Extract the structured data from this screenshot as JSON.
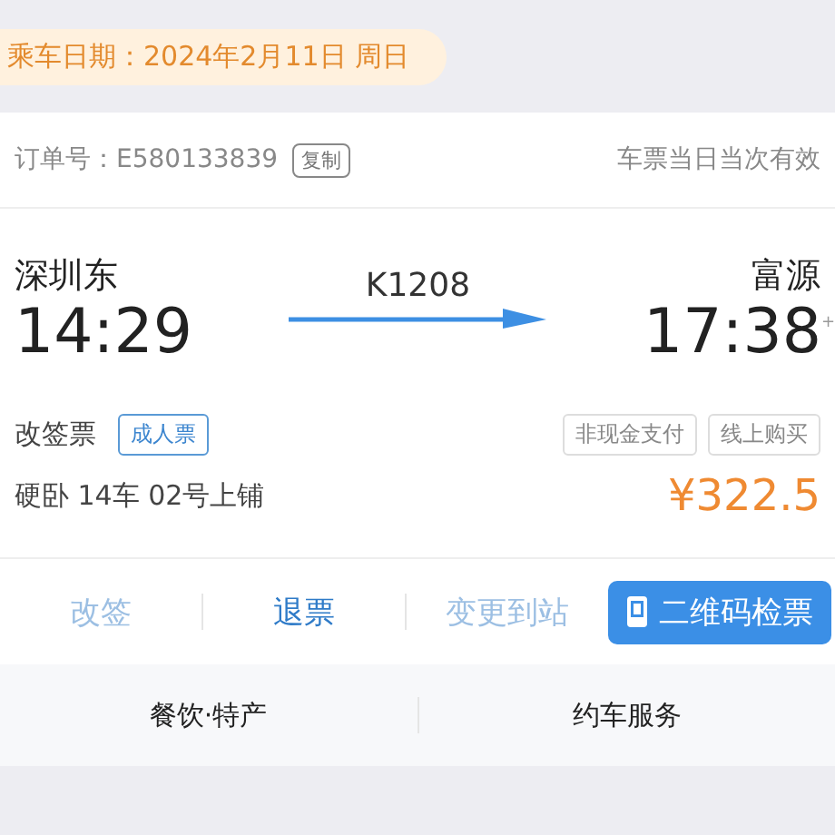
{
  "travel_date": "乘车日期：2024年2月11日 周日",
  "order": {
    "label": "订单号：E580133839",
    "copy_button": "复制",
    "validity": "车票当日当次有效"
  },
  "trip": {
    "from_station": "深圳东",
    "depart_time": "14:29",
    "train_no": "K1208",
    "to_station": "富源",
    "arrive_time": "17:38",
    "arrive_mark": "+"
  },
  "ticket": {
    "type": "改签票",
    "passenger_tag": "成人票",
    "payment_tags": [
      "非现金支付",
      "线上购买"
    ],
    "seat": "硬卧 14车 02号上铺",
    "price": "¥322.5"
  },
  "actions": [
    {
      "label": "改签",
      "kind": "text",
      "disabled": true
    },
    {
      "label": "退票",
      "kind": "text",
      "disabled": false
    },
    {
      "label": "变更到站",
      "kind": "text",
      "disabled": true
    },
    {
      "label": "二维码检票",
      "kind": "primary",
      "disabled": false
    }
  ],
  "services": [
    "餐饮·特产",
    "约车服务"
  ]
}
